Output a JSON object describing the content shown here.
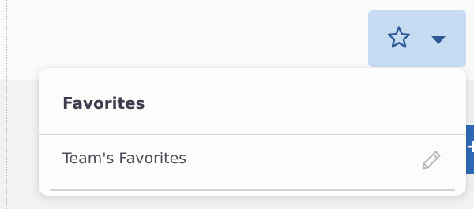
{
  "colors": {
    "trigger_background": "#c7dcf3",
    "icon_blue": "#2f5a96",
    "panel_background": "#fcfcfb",
    "title_text": "#3d3d4e",
    "item_text": "#4b4b58",
    "edit_icon": "#b8b8b8",
    "side_accent": "#2f6ab7"
  },
  "favorites_button": {
    "icon": "star-outline-icon",
    "dropdown_icon": "caret-down-icon"
  },
  "favorites_panel": {
    "title": "Favorites",
    "items": [
      {
        "label": "Team's Favorites",
        "action_icon": "pencil-icon"
      }
    ]
  }
}
